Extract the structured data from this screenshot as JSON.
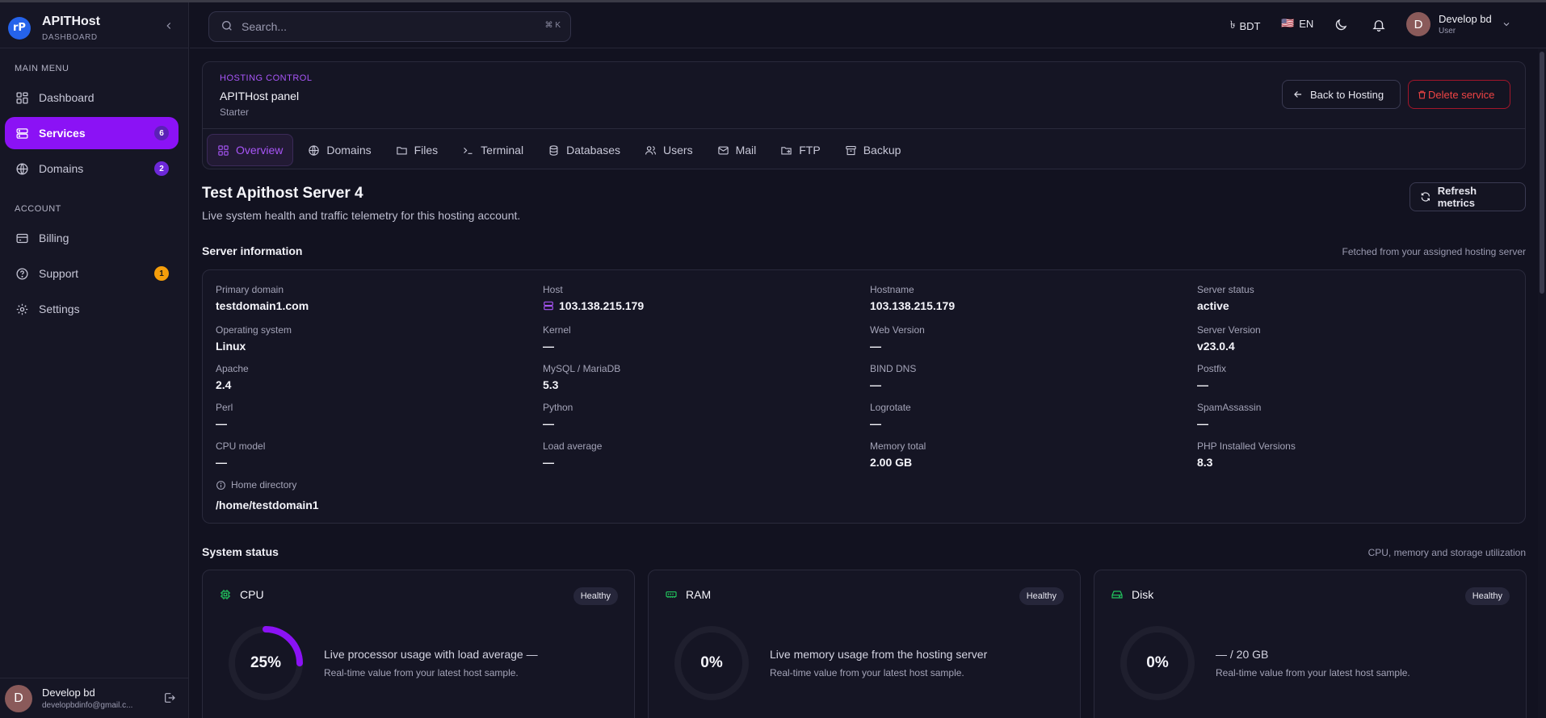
{
  "app": {
    "name": "APITHost",
    "subtitle": "DASHBOARD",
    "logo_text": "rP"
  },
  "sidebar": {
    "main_menu_label": "MAIN MENU",
    "account_label": "ACCOUNT",
    "main_items": [
      {
        "label": "Dashboard",
        "icon": "grid-icon"
      },
      {
        "label": "Services",
        "icon": "server-icon",
        "badge": "6",
        "active": true
      },
      {
        "label": "Domains",
        "icon": "globe-icon",
        "badge": "2"
      }
    ],
    "account_items": [
      {
        "label": "Billing",
        "icon": "credit-card-icon"
      },
      {
        "label": "Support",
        "icon": "help-circle-icon",
        "badge": "1"
      },
      {
        "label": "Settings",
        "icon": "gear-icon"
      }
    ],
    "user": {
      "initial": "D",
      "name": "Develop bd",
      "email": "developbdinfo@gmail.c..."
    }
  },
  "topbar": {
    "search_placeholder": "Search...",
    "search_shortcut": "⌘ K",
    "currency_symbol": "৳",
    "currency": "BDT",
    "flag": "🇺🇸",
    "language": "EN",
    "user": {
      "initial": "D",
      "name": "Develop bd",
      "role": "User"
    }
  },
  "panel": {
    "eyebrow": "HOSTING CONTROL",
    "title": "APITHost panel",
    "plan": "Starter",
    "back_label": "Back to Hosting",
    "delete_label": "Delete service",
    "tabs": [
      {
        "label": "Overview",
        "icon": "grid-icon",
        "active": true
      },
      {
        "label": "Domains",
        "icon": "globe-icon"
      },
      {
        "label": "Files",
        "icon": "folder-icon"
      },
      {
        "label": "Terminal",
        "icon": "terminal-icon"
      },
      {
        "label": "Databases",
        "icon": "database-icon"
      },
      {
        "label": "Users",
        "icon": "users-icon"
      },
      {
        "label": "Mail",
        "icon": "mail-icon"
      },
      {
        "label": "FTP",
        "icon": "folder-share-icon"
      },
      {
        "label": "Backup",
        "icon": "archive-icon"
      }
    ]
  },
  "page": {
    "title": "Test Apithost Server 4",
    "subtitle": "Live system health and traffic telemetry for this hosting account.",
    "refresh_label": "Refresh metrics"
  },
  "server_info": {
    "title": "Server information",
    "note": "Fetched from your assigned hosting server",
    "fields": [
      {
        "label": "Primary domain",
        "value": "testdomain1.com"
      },
      {
        "label": "Host",
        "value": "103.138.215.179"
      },
      {
        "label": "Hostname",
        "value": "103.138.215.179"
      },
      {
        "label": "Server status",
        "value": "active"
      },
      {
        "label": "Operating system",
        "value": "Linux"
      },
      {
        "label": "Kernel",
        "value": "—"
      },
      {
        "label": "Web Version",
        "value": "—"
      },
      {
        "label": "Server Version",
        "value": "v23.0.4"
      },
      {
        "label": "Apache",
        "value": "2.4"
      },
      {
        "label": "MySQL / MariaDB",
        "value": "5.3"
      },
      {
        "label": "BIND DNS",
        "value": "—"
      },
      {
        "label": "Postfix",
        "value": "—"
      },
      {
        "label": "Perl",
        "value": "—"
      },
      {
        "label": "Python",
        "value": "—"
      },
      {
        "label": "Logrotate",
        "value": "—"
      },
      {
        "label": "SpamAssassin",
        "value": "—"
      },
      {
        "label": "CPU model",
        "value": "—"
      },
      {
        "label": "Load average",
        "value": "—"
      },
      {
        "label": "Memory total",
        "value": "2.00 GB"
      },
      {
        "label": "PHP Installed Versions",
        "value": "8.3"
      }
    ],
    "home_dir_label": "Home directory",
    "home_dir_value": "/home/testdomain1"
  },
  "system_status": {
    "title": "System status",
    "note": "CPU, memory and storage utilization",
    "cards": [
      {
        "name": "CPU",
        "status": "Healthy",
        "percent_text": "25%",
        "percent": 25,
        "desc": "Live processor usage with load average —",
        "note": "Real-time value from your latest host sample."
      },
      {
        "name": "RAM",
        "status": "Healthy",
        "percent_text": "0%",
        "percent": 0,
        "desc": "Live memory usage from the hosting server",
        "note": "Real-time value from your latest host sample."
      },
      {
        "name": "Disk",
        "status": "Healthy",
        "percent_text": "0%",
        "percent": 0,
        "desc": "— / 20 GB",
        "note": "Real-time value from your latest host sample."
      }
    ]
  },
  "colors": {
    "accent": "#8b12f5",
    "danger": "#ef4444",
    "metric_icon": "#22c55e",
    "background": "#121220"
  }
}
